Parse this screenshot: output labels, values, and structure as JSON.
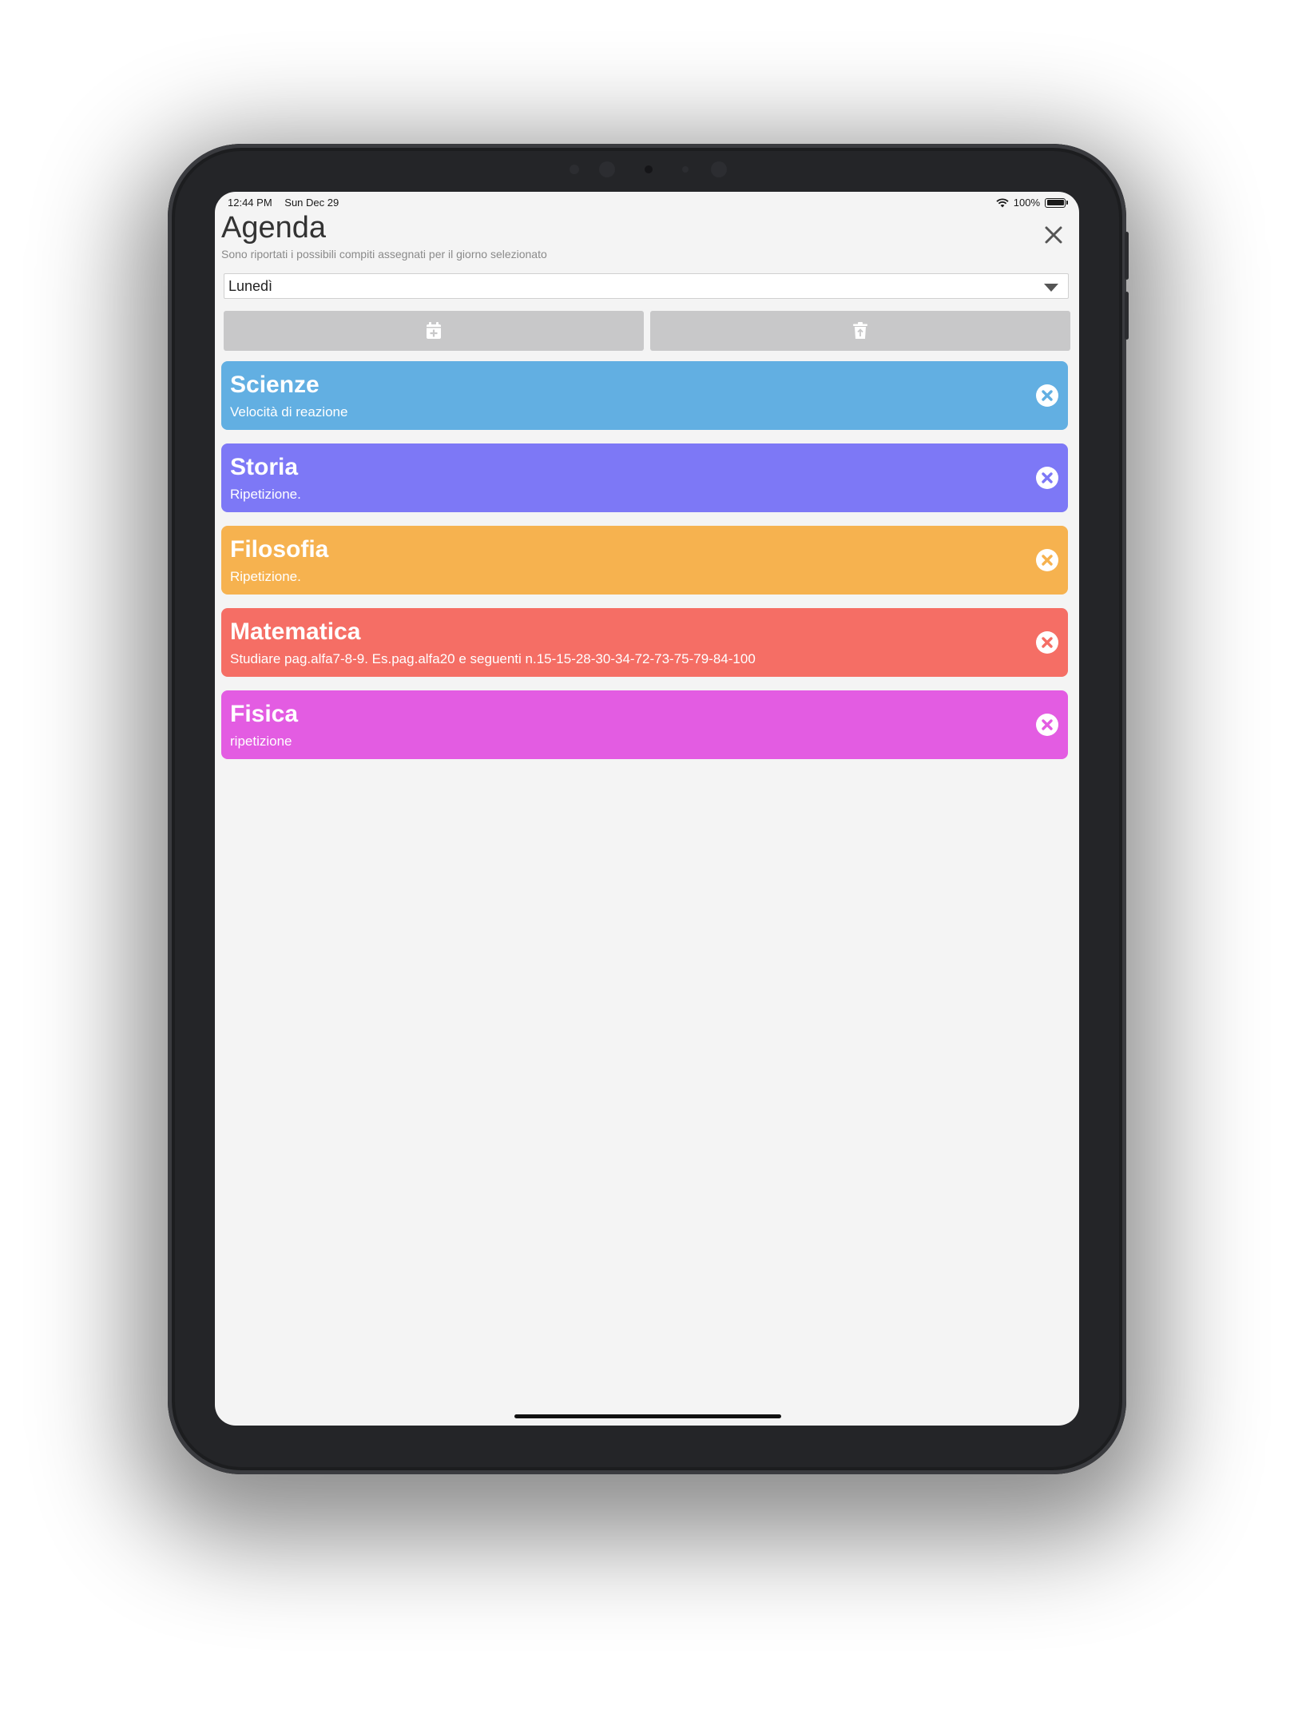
{
  "status_bar": {
    "time": "12:44 PM",
    "date": "Sun Dec 29",
    "battery_text": "100%",
    "battery_level": 1.0
  },
  "header": {
    "title": "Agenda",
    "subtitle": "Sono riportati i possibili compiti assegnati per il giorno selezionato",
    "close_icon": "close-x-icon"
  },
  "day_select": {
    "value": "Lunedì"
  },
  "toolbar": {
    "add_icon": "calendar-plus-icon",
    "delete_icon": "trash-icon"
  },
  "tasks": [
    {
      "subject": "Scienze",
      "description": "Velocità di reazione",
      "color": "#62afe2"
    },
    {
      "subject": "Storia",
      "description": "Ripetizione.",
      "color": "#7d78f6"
    },
    {
      "subject": "Filosofia",
      "description": "Ripetizione.",
      "color": "#f6b24f"
    },
    {
      "subject": "Matematica",
      "description": "Studiare pag.alfa7-8-9. Es.pag.alfa20 e seguenti n.15-15-28-30-34-72-73-75-79-84-100",
      "color": "#f56e65"
    },
    {
      "subject": "Fisica",
      "description": "ripetizione",
      "color": "#e35ce2"
    }
  ]
}
